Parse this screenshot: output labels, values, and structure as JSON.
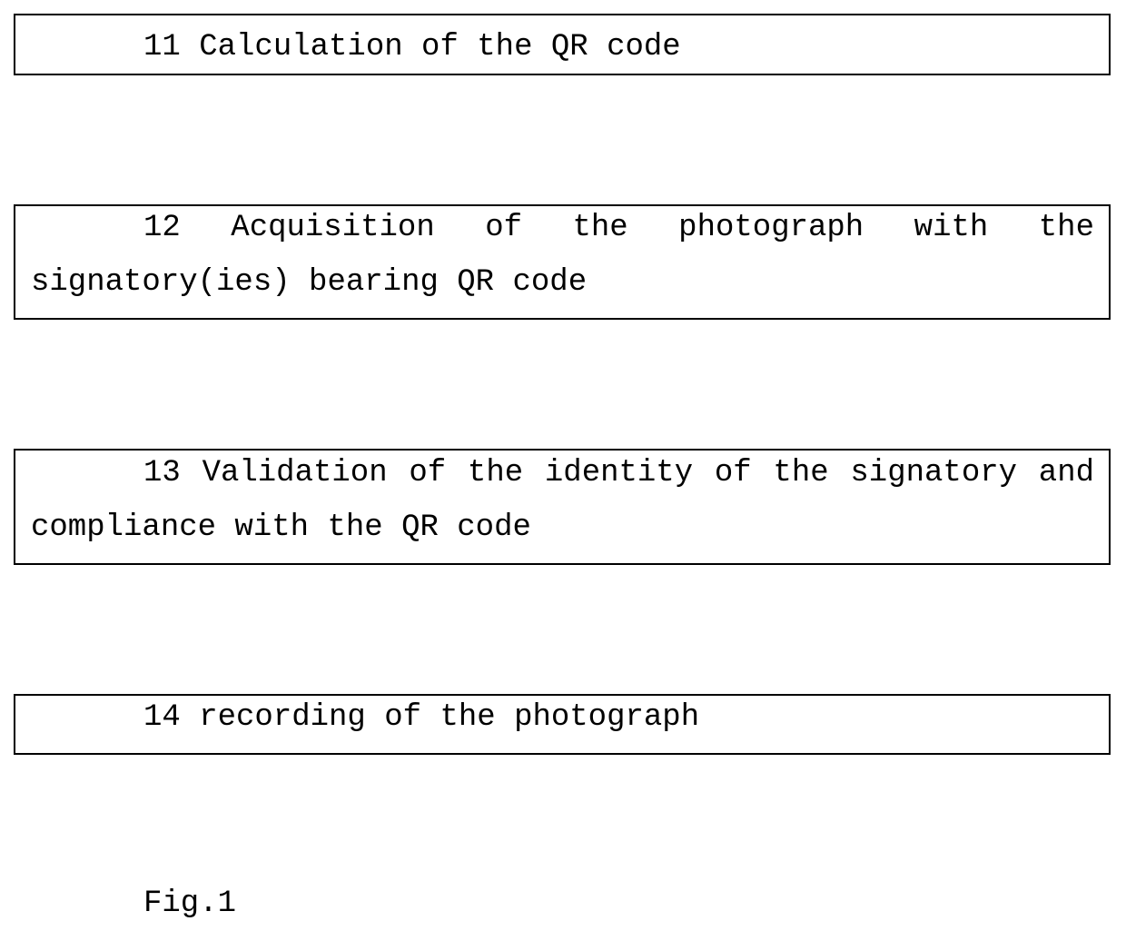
{
  "steps": [
    {
      "number": "11",
      "text": "11 Calculation of the QR code"
    },
    {
      "number": "12",
      "text": "12 Acquisition of the photograph with the signatory(ies) bearing QR code"
    },
    {
      "number": "13",
      "text": "13 Validation of the identity of the signatory and compliance with the QR code"
    },
    {
      "number": "14",
      "text": "14 recording of the photograph"
    }
  ],
  "caption": "Fig.1"
}
